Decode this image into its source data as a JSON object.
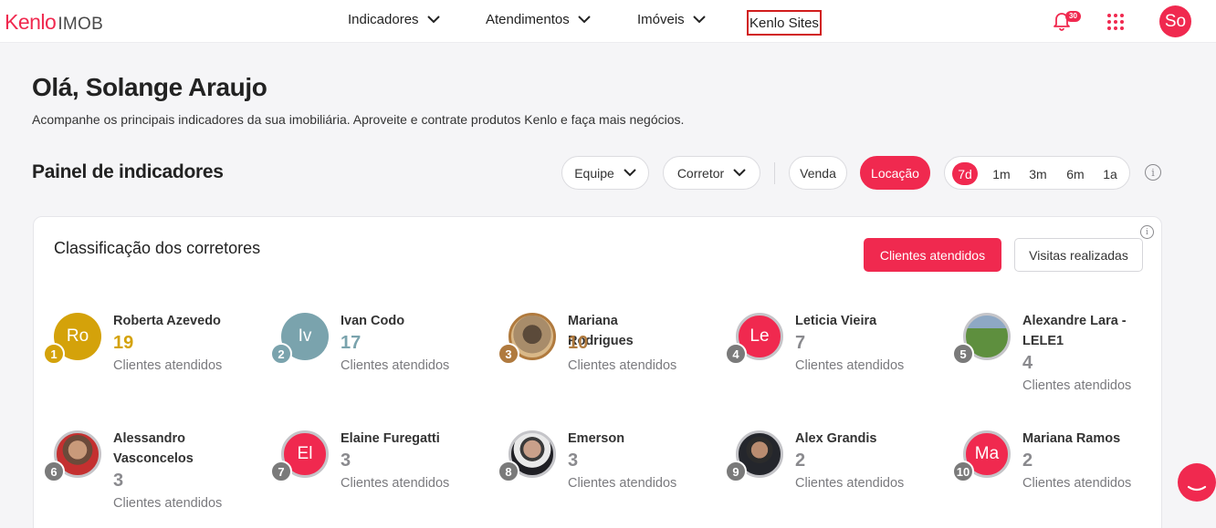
{
  "app": {
    "brand": "Kenlo",
    "product": "IMOB"
  },
  "nav": {
    "indicadores": "Indicadores",
    "atendimentos": "Atendimentos",
    "imoveis": "Imóveis",
    "sites": "Kenlo Sites"
  },
  "notifications": {
    "count": "30",
    "icon": "bell-icon"
  },
  "user": {
    "initials": "So"
  },
  "greeting": "Olá, Solange Araujo",
  "subtitle": "Acompanhe os principais indicadores da sua imobiliária. Aproveite e contrate produtos Kenlo e faça mais negócios.",
  "panel": {
    "title": "Painel de indicadores",
    "filters": {
      "equipe": "Equipe",
      "corretor": "Corretor"
    },
    "modes": {
      "venda": "Venda",
      "locacao": "Locação",
      "selected": "Locação"
    },
    "periods": [
      "7d",
      "1m",
      "3m",
      "6m",
      "1a"
    ],
    "selected_period": "7d"
  },
  "ranking": {
    "title": "Classificação dos corretores",
    "tab_active": "Clientes atendidos",
    "tab_inactive": "Visitas realizadas",
    "metric_label": "Clientes atendidos",
    "colors": {
      "gold": "#d4a20a",
      "silver": "#7aa3ad",
      "bronze": "#b07a3e",
      "default": "#7a7a7a",
      "accent": "#f0294f"
    },
    "brokers": [
      {
        "rank": "1",
        "name": "Roberta Azevedo",
        "initials": "Ro",
        "count": "19",
        "label": "Clientes atendidos"
      },
      {
        "rank": "2",
        "name": "Ivan Codo",
        "initials": "Iv",
        "count": "17",
        "label": "Clientes atendidos"
      },
      {
        "rank": "3",
        "name": "Mariana Rodrigues",
        "initials": "",
        "count": "10",
        "label": "Clientes atendidos"
      },
      {
        "rank": "4",
        "name": "Leticia Vieira",
        "initials": "Le",
        "count": "7",
        "label": "Clientes atendidos"
      },
      {
        "rank": "5",
        "name": "Alexandre Lara - LELE1",
        "initials": "",
        "count": "4",
        "label": "Clientes atendidos"
      },
      {
        "rank": "6",
        "name": "Alessandro Vasconcelos",
        "initials": "",
        "count": "3",
        "label": "Clientes atendidos"
      },
      {
        "rank": "7",
        "name": "Elaine Furegatti",
        "initials": "El",
        "count": "3",
        "label": "Clientes atendidos"
      },
      {
        "rank": "8",
        "name": "Emerson",
        "initials": "",
        "count": "3",
        "label": "Clientes atendidos"
      },
      {
        "rank": "9",
        "name": "Alex Grandis",
        "initials": "",
        "count": "2",
        "label": "Clientes atendidos"
      },
      {
        "rank": "10",
        "name": "Mariana Ramos",
        "initials": "Ma",
        "count": "2",
        "label": "Clientes atendidos"
      }
    ]
  }
}
